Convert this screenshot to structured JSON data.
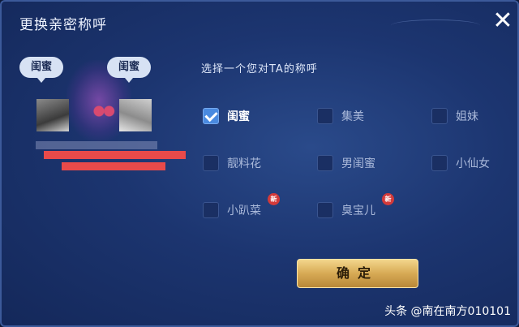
{
  "dialog": {
    "title": "更换亲密称呼",
    "close_icon": "close-icon"
  },
  "avatars": {
    "left_bubble": "闺蜜",
    "right_bubble": "闺蜜"
  },
  "options": {
    "prompt": "选择一个您对TA的称呼",
    "items": [
      {
        "label": "闺蜜",
        "checked": true,
        "new": false
      },
      {
        "label": "集美",
        "checked": false,
        "new": false
      },
      {
        "label": "姐妹",
        "checked": false,
        "new": false
      },
      {
        "label": "靓料花",
        "checked": false,
        "new": false
      },
      {
        "label": "男闺蜜",
        "checked": false,
        "new": false
      },
      {
        "label": "小仙女",
        "checked": false,
        "new": false
      },
      {
        "label": "小趴菜",
        "checked": false,
        "new": true
      },
      {
        "label": "臭宝儿",
        "checked": false,
        "new": true
      }
    ],
    "new_badge": "新"
  },
  "confirm_label": "确定",
  "watermark": "头条 @南在南方010101",
  "colors": {
    "accent": "#4a8ae0",
    "button_gold": "#d7aa55",
    "badge_red": "#d33a3a"
  }
}
